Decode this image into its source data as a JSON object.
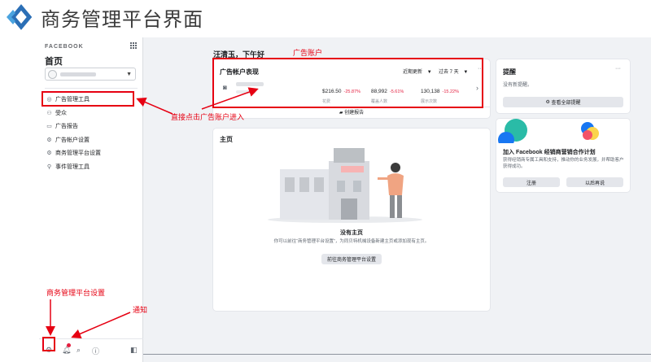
{
  "banner": {
    "title": "商务管理平台界面"
  },
  "sidebar": {
    "brand": "FACEBOOK",
    "home_title": "首页",
    "items": [
      {
        "label": "广告管理工具",
        "icon": "target-icon"
      },
      {
        "label": "受众",
        "icon": "audience-icon"
      },
      {
        "label": "广告报告",
        "icon": "report-icon"
      },
      {
        "label": "广告帐户设置",
        "icon": "ad-settings-icon"
      },
      {
        "label": "商务管理平台设置",
        "icon": "gear-icon"
      },
      {
        "label": "事件管理工具",
        "icon": "events-icon"
      }
    ],
    "bottom_icons": [
      "settings-icon",
      "notification-bell-icon",
      "search-icon",
      "help-icon",
      "panel-toggle-icon"
    ]
  },
  "main": {
    "greeting": "汪清玉，下午好",
    "ad_accounts": {
      "title": "广告帐户表现",
      "filter_label": "近期更新",
      "range_label": "过去 7 天",
      "more": "···",
      "metrics": [
        {
          "value": "$216.50",
          "change": "-25.87%",
          "label": "花费"
        },
        {
          "value": "88,992",
          "change": "-5.61%",
          "label": "覆盖人数"
        },
        {
          "value": "130,138",
          "change": "-15.22%",
          "label": "展示次数"
        }
      ],
      "create_report": "创建报告"
    },
    "home_pages": {
      "title": "主页",
      "empty_title": "没有主页",
      "empty_desc": "你可以前往“商务管理平台设置”，为同贝特机械设备新建主页或添加现有主页。",
      "button": "前往商务管理平台设置"
    },
    "reminders": {
      "title": "提醒",
      "more": "···",
      "empty": "没有新提醒。",
      "button": "查看全部提醒"
    },
    "partner": {
      "title": "加入 Facebook 经销商营销合作计划",
      "desc": "获得经销商专属工具和支持，推动你的业务发展，并帮助客户获得成功。",
      "btn_register": "注册",
      "btn_later": "以后再说"
    }
  },
  "annotations": {
    "ad_account_label": "广告账户",
    "click_hint": "直接点击广告账户进入",
    "settings_label": "商务管理平台设置",
    "notice_label": "通知"
  },
  "colors": {
    "annotation_red": "#e60012",
    "fb_blue": "#1877f2",
    "negative": "#e41e3f"
  }
}
